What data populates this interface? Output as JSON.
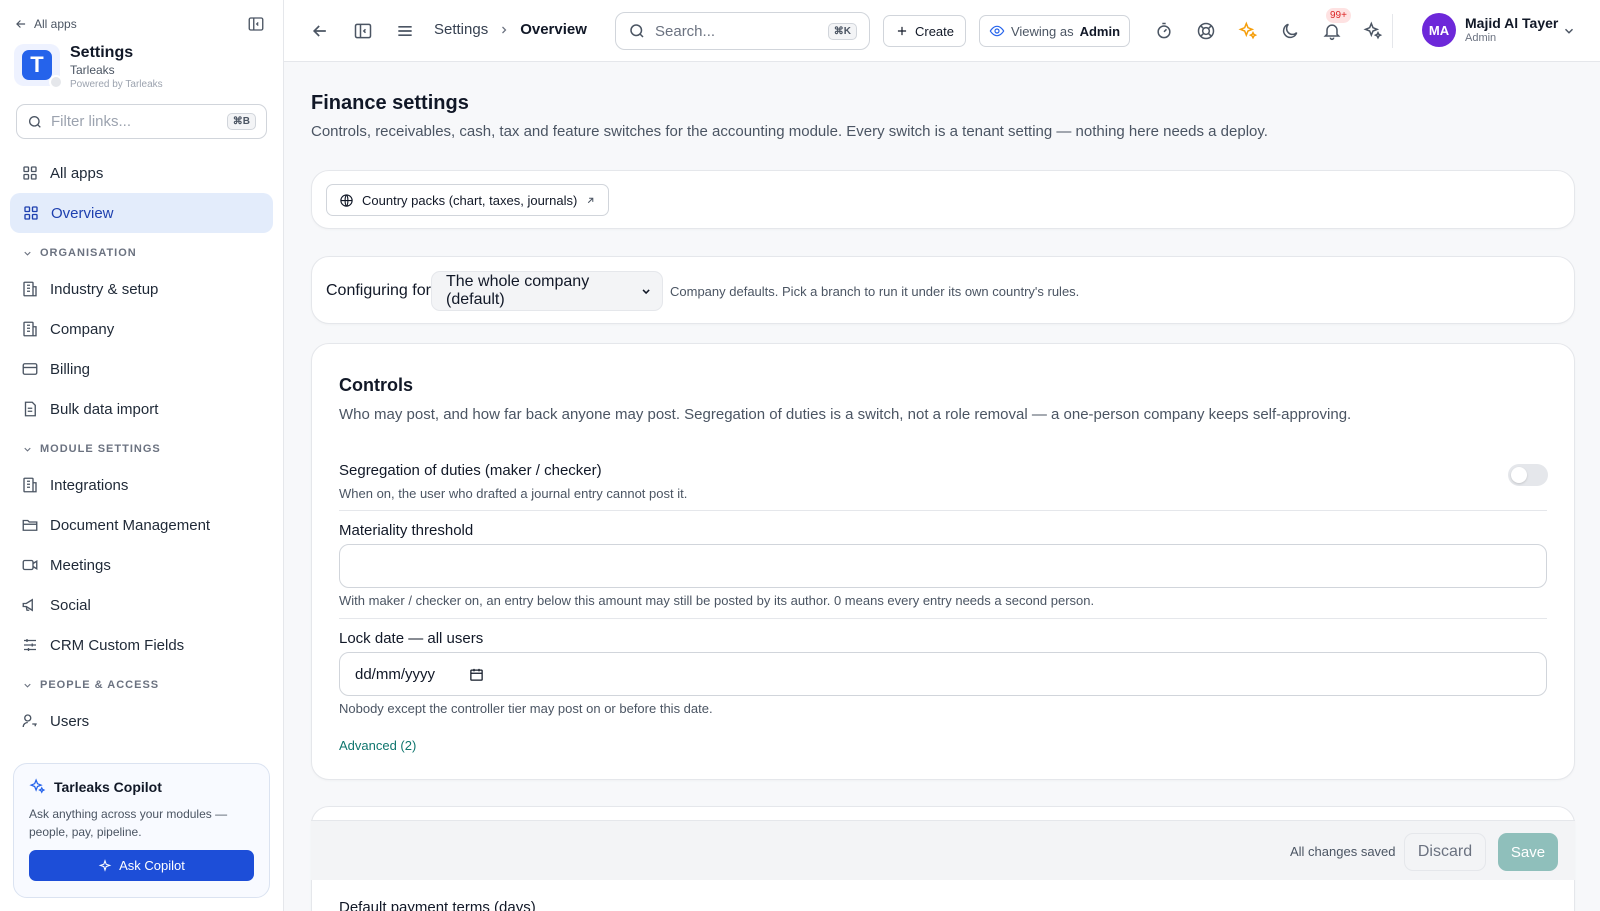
{
  "sidebar": {
    "back_label": "All apps",
    "brand": {
      "name": "Settings",
      "org": "Tarleaks",
      "powered": "Powered by Tarleaks",
      "logo_letter": "T"
    },
    "filter": {
      "placeholder": "Filter links...",
      "shortcut": "⌘B"
    },
    "top_items": [
      {
        "label": "All apps",
        "icon": "grid-icon"
      },
      {
        "label": "Overview",
        "icon": "grid-icon",
        "active": true
      }
    ],
    "sections": [
      {
        "title": "ORGANISATION",
        "items": [
          {
            "label": "Industry & setup",
            "icon": "building-icon"
          },
          {
            "label": "Company",
            "icon": "building-icon"
          },
          {
            "label": "Billing",
            "icon": "credit-card-icon"
          },
          {
            "label": "Bulk data import",
            "icon": "document-icon"
          }
        ]
      },
      {
        "title": "MODULE SETTINGS",
        "items": [
          {
            "label": "Integrations",
            "icon": "building-icon"
          },
          {
            "label": "Document Management",
            "icon": "folder-icon"
          },
          {
            "label": "Meetings",
            "icon": "video-icon"
          },
          {
            "label": "Social",
            "icon": "megaphone-icon"
          },
          {
            "label": "CRM Custom Fields",
            "icon": "sliders-icon"
          }
        ]
      },
      {
        "title": "PEOPLE & ACCESS",
        "items": [
          {
            "label": "Users",
            "icon": "user-key-icon"
          }
        ]
      }
    ],
    "copilot": {
      "title": "Tarleaks Copilot",
      "description": "Ask anything across your modules — people, pay, pipeline.",
      "button_label": "Ask Copilot"
    }
  },
  "topbar": {
    "breadcrumb": [
      "Settings",
      "Overview"
    ],
    "search": {
      "placeholder": "Search...",
      "shortcut": "⌘K"
    },
    "create_label": "Create",
    "viewing_as_label": "Viewing as",
    "viewing_as_role": "Admin",
    "notification_count": "99+",
    "user": {
      "initials": "MA",
      "name": "Majid Al Tayer",
      "role": "Admin"
    },
    "colors": {
      "sparkle": "#f59e0b",
      "avatar": "#6d28d9",
      "badge": "#dc2626"
    }
  },
  "main": {
    "title": "Finance settings",
    "subtitle": "Controls, receivables, cash, tax and feature switches for the accounting module. Every switch is a tenant setting — nothing here needs a deploy.",
    "country_pack_label": "Country packs (chart, taxes, journals)",
    "configuring": {
      "label": "Configuring for",
      "selected": "The whole company (default)",
      "hint": "Company defaults. Pick a branch to run it under its own country's rules."
    },
    "controls": {
      "title": "Controls",
      "description": "Who may post, and how far back anyone may post. Segregation of duties is a switch, not a role removal — a one-person company keeps self-approving.",
      "segregation": {
        "label": "Segregation of duties (maker / checker)",
        "help": "When on, the user who drafted a journal entry cannot post it.",
        "enabled": false
      },
      "materiality": {
        "label": "Materiality threshold",
        "value": "",
        "help": "With maker / checker on, an entry below this amount may still be posted by its author. 0 means every entry needs a second person."
      },
      "lock_date": {
        "label": "Lock date — all users",
        "placeholder": "dd/mm/yyyy",
        "help": "Nobody except the controller tier may post on or before this date."
      },
      "advanced_label": "Advanced (2)"
    },
    "next_field_label": "Default payment terms (days)",
    "save_bar": {
      "status": "All changes saved",
      "discard_label": "Discard",
      "save_label": "Save"
    },
    "colors": {
      "accent": "#0f766e",
      "save_button": "#8fbfbb",
      "active_nav": "#e3ecfb"
    }
  }
}
